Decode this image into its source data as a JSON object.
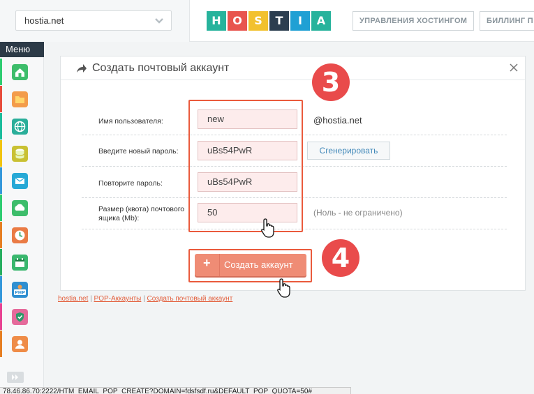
{
  "header": {
    "domain_selected": "hostia.net",
    "logo_letters": [
      {
        "letter": "H",
        "color": "#27b39c"
      },
      {
        "letter": "O",
        "color": "#e8554e"
      },
      {
        "letter": "S",
        "color": "#f2c12e"
      },
      {
        "letter": "T",
        "color": "#2c3e50"
      },
      {
        "letter": "I",
        "color": "#1fa0d4"
      },
      {
        "letter": "A",
        "color": "#27b39c"
      }
    ],
    "nav": [
      "УПРАВЛЕНИЯ ХОСТИНГОМ",
      "БИЛЛИНГ П"
    ]
  },
  "sidebar": {
    "menu_label": "Меню",
    "items": [
      {
        "icon": "home-icon",
        "strip": "#2ecc71",
        "bg": "#3dbd6b"
      },
      {
        "icon": "folder-icon",
        "strip": "#e74c3c",
        "bg": "#f39c4b"
      },
      {
        "icon": "www-icon",
        "strip": "#1abc9c",
        "bg": "#2aae9a"
      },
      {
        "icon": "database-icon",
        "strip": "#f1c40f",
        "bg": "#c9c133"
      },
      {
        "icon": "mail-icon",
        "strip": "#3498db",
        "bg": "#27a9d6"
      },
      {
        "icon": "ftp-icon",
        "strip": "#2ecc71",
        "bg": "#3dbd6b"
      },
      {
        "icon": "clock-icon",
        "strip": "#e67e22",
        "bg": "#ea7b45"
      },
      {
        "icon": "calendar-icon",
        "strip": "#27ae60",
        "bg": "#3ab76e"
      },
      {
        "icon": "php-icon",
        "strip": "#3498db",
        "bg": "#2f8fd1"
      },
      {
        "icon": "shield-icon",
        "strip": "#e84393",
        "bg": "#e56a9b"
      },
      {
        "icon": "user-icon",
        "strip": "#e67e22",
        "bg": "#ef8c48"
      }
    ]
  },
  "panel": {
    "title": "Создать почтовый аккаунт",
    "fields": {
      "username_label": "Имя пользователя:",
      "username_value": "new",
      "domain_suffix": "@hostia.net",
      "password_label": "Введите новый пароль:",
      "password_value": "uBs54PwR",
      "generate_label": "Сгенерировать",
      "repeat_label": "Повторите пароль:",
      "repeat_value": "uBs54PwR",
      "quota_label_1": "Размер (квота) почтового",
      "quota_label_2": "ящика (Mb):",
      "quota_value": "50",
      "quota_hint": "(Ноль - не ограничено)"
    },
    "create_plus": "+",
    "create_label": "Создать аккаунт"
  },
  "annotations": {
    "step_3": "3",
    "step_4": "4",
    "highlight_color": "#ea5a3c"
  },
  "breadcrumb": {
    "home": "hostia.net",
    "sep": "|",
    "pop": "POP-Аккаунты",
    "current": "Создать почтовый аккаунт"
  },
  "status_url": "78.46.86.70:2222/HTM_EMAIL_POP_CREATE?DOMAIN=fdsfsdf.ru&DEFAULT_POP_QUOTA=50#"
}
